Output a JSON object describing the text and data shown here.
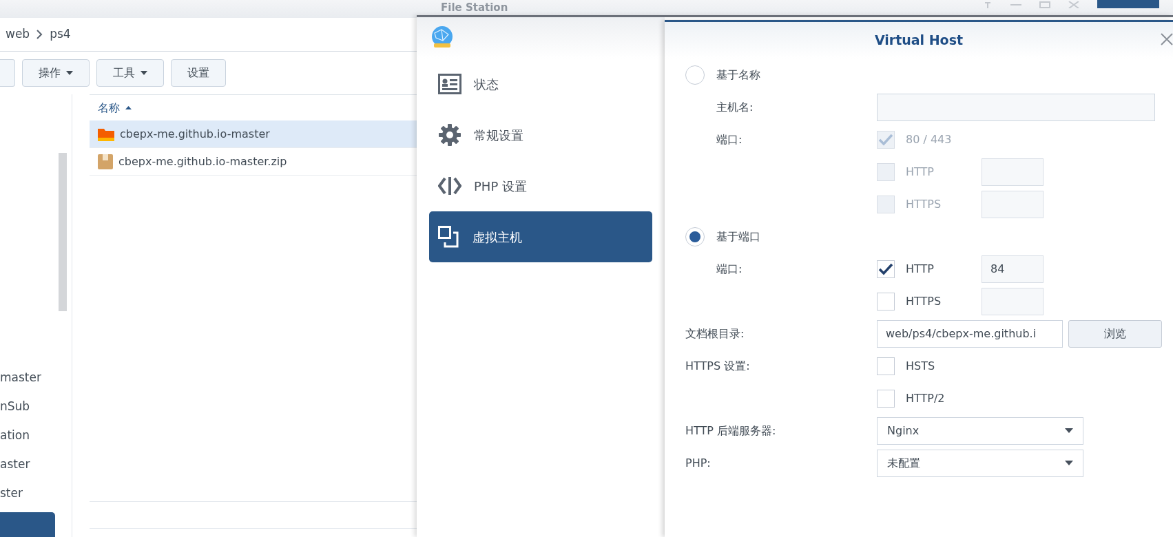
{
  "file_station": {
    "title": "File Station",
    "breadcrumb": [
      "web",
      "ps4"
    ],
    "toolbar": [
      {
        "label": "操作",
        "dropdown": true
      },
      {
        "label": "工具",
        "dropdown": true
      },
      {
        "label": "设置",
        "dropdown": false
      }
    ],
    "sidebar": {
      "items": [
        {
          "label": "master",
          "selected": false
        },
        {
          "label": "nSub",
          "selected": false
        },
        {
          "label": "ation",
          "selected": false
        },
        {
          "label": "aster",
          "selected": false
        },
        {
          "label": "ster",
          "selected": false
        },
        {
          "selected": true
        }
      ]
    },
    "file_list": {
      "column": "名称",
      "sort_ascending": true,
      "rows": [
        {
          "name": "cbepx-me.github.io-master",
          "kind": "folder",
          "selected": true
        },
        {
          "name": "cbepx-me.github.io-master.zip",
          "kind": "archive",
          "selected": false
        }
      ]
    }
  },
  "web_station": {
    "nav": [
      {
        "label": "状态",
        "selected": false
      },
      {
        "label": "常规设置",
        "selected": false
      },
      {
        "label": "PHP 设置",
        "selected": false
      },
      {
        "label": "虚拟主机",
        "selected": true
      }
    ]
  },
  "dialog": {
    "title": "Virtual Host",
    "rows": [
      {
        "kind": "radio",
        "label": "基于名称",
        "selected": false,
        "children": [
          {
            "kind": "text",
            "label": "主机名:"
          },
          {
            "kind": "checkbox",
            "label": "端口:",
            "option": "80 / 443",
            "checked": true,
            "disabled": true
          },
          {
            "kind": "port",
            "option": "HTTP",
            "checked": false,
            "disabled": true
          },
          {
            "kind": "port",
            "option": "HTTPS",
            "checked": false,
            "disabled": true
          }
        ]
      },
      {
        "kind": "radio",
        "label": "基于端口",
        "selected": true,
        "children": [
          {
            "kind": "port",
            "label": "端口:",
            "option": "HTTP",
            "checked": true,
            "disabled": false,
            "value": "84"
          },
          {
            "kind": "port",
            "option": "HTTPS",
            "checked": false,
            "disabled": false
          }
        ]
      },
      {
        "kind": "path",
        "label": "文档根目录:",
        "value": "web/ps4/cbepx-me.github.i",
        "button": "浏览"
      },
      {
        "kind": "checkbox",
        "label": "HTTPS 设置:",
        "option": "HSTS",
        "checked": false,
        "disabled": false
      },
      {
        "kind": "checkbox",
        "option": "HTTP/2",
        "checked": false,
        "disabled": false
      },
      {
        "kind": "select",
        "label": "HTTP 后端服务器:",
        "value": "Nginx"
      },
      {
        "kind": "select",
        "label": "PHP:",
        "value": "未配置"
      }
    ]
  }
}
